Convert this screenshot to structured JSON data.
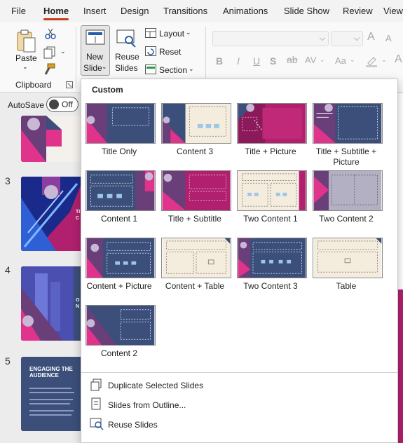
{
  "tabs": [
    "File",
    "Home",
    "Insert",
    "Design",
    "Transitions",
    "Animations",
    "Slide Show",
    "Review",
    "View"
  ],
  "active_tab": "Home",
  "ribbon": {
    "paste_label": "Paste",
    "clipboard_group": "Clipboard",
    "new_slide_line1": "New",
    "new_slide_line2": "Slide",
    "reuse_line1": "Reuse",
    "reuse_line2": "Slides",
    "layout_label": "Layout",
    "reset_label": "Reset",
    "section_label": "Section",
    "font_grow": "A",
    "font_shrink": "A",
    "bold": "B",
    "italic": "I",
    "underline": "U",
    "strike": "S",
    "spacing": "AV",
    "case": "Aa"
  },
  "autosave": {
    "label": "AutoSave",
    "state": "Off"
  },
  "slides": [
    {
      "number": "3"
    },
    {
      "number": "4"
    },
    {
      "number": "5",
      "title": "ENGAGING THE AUDIENCE"
    }
  ],
  "gallery": {
    "title": "Custom",
    "layouts": [
      {
        "name": "Title Only"
      },
      {
        "name": "Content 3"
      },
      {
        "name": "Title + Picture"
      },
      {
        "name": "Title + Subtitle + Picture"
      },
      {
        "name": "Content 1"
      },
      {
        "name": "Title + Subtitle"
      },
      {
        "name": "Two Content 1"
      },
      {
        "name": "Two Content 2"
      },
      {
        "name": "Content + Picture"
      },
      {
        "name": "Content + Table"
      },
      {
        "name": "Two Content 3"
      },
      {
        "name": "Table"
      },
      {
        "name": "Content 2"
      }
    ],
    "commands": [
      {
        "label": "Duplicate Selected Slides"
      },
      {
        "label": "Slides from Outline..."
      },
      {
        "label": "Reuse Slides"
      }
    ]
  },
  "colors": {
    "navy": "#3b4f7a",
    "magenta": "#b0206e",
    "pink": "#e0338c",
    "cream": "#f4ecdc",
    "accent": "#c43e1c"
  }
}
